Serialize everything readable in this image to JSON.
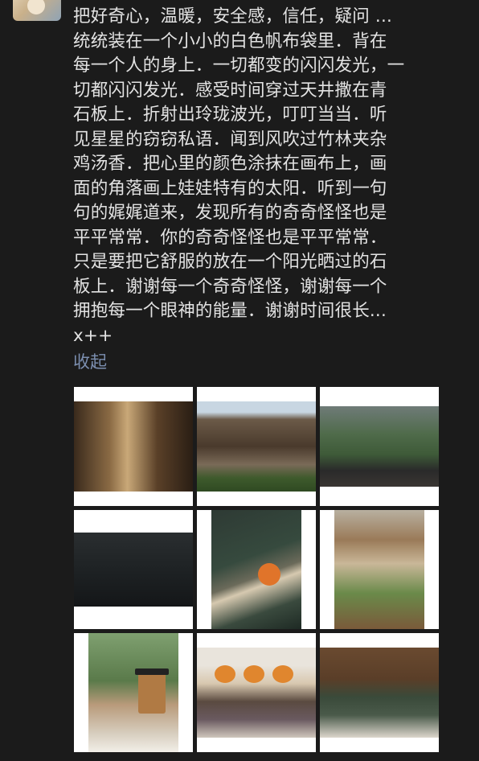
{
  "post": {
    "text": "把好奇心，温暖，安全感，信任，疑问 ... \n统统装在一个小小的白色帆布袋里．背在\n每一个人的身上．一切都变的闪闪发光，一\n切都闪闪发光．感受时间穿过天井撒在青\n石板上．折射出玲珑波光，叮叮当当．听\n见星星的窃窃私语．闻到风吹过竹林夹杂\n鸡汤香．把心里的颜色涂抹在画布上，画\n面的角落画上娃娃特有的太阳．听到一句\n句的娓娓道来，发现所有的奇奇怪怪也是\n平平常常．你的奇奇怪怪也是平平常常．\n只是要把它舒服的放在一个阳光晒过的石\n板上．谢谢每一个奇奇怪怪，谢谢每一个\n拥抱每一个眼神的能量．谢谢时间很长...\nx++",
    "collapse_label": "收起"
  },
  "colors": {
    "background": "#1b1b1b",
    "text": "#e3e3e3",
    "link": "#7c8fb0"
  }
}
